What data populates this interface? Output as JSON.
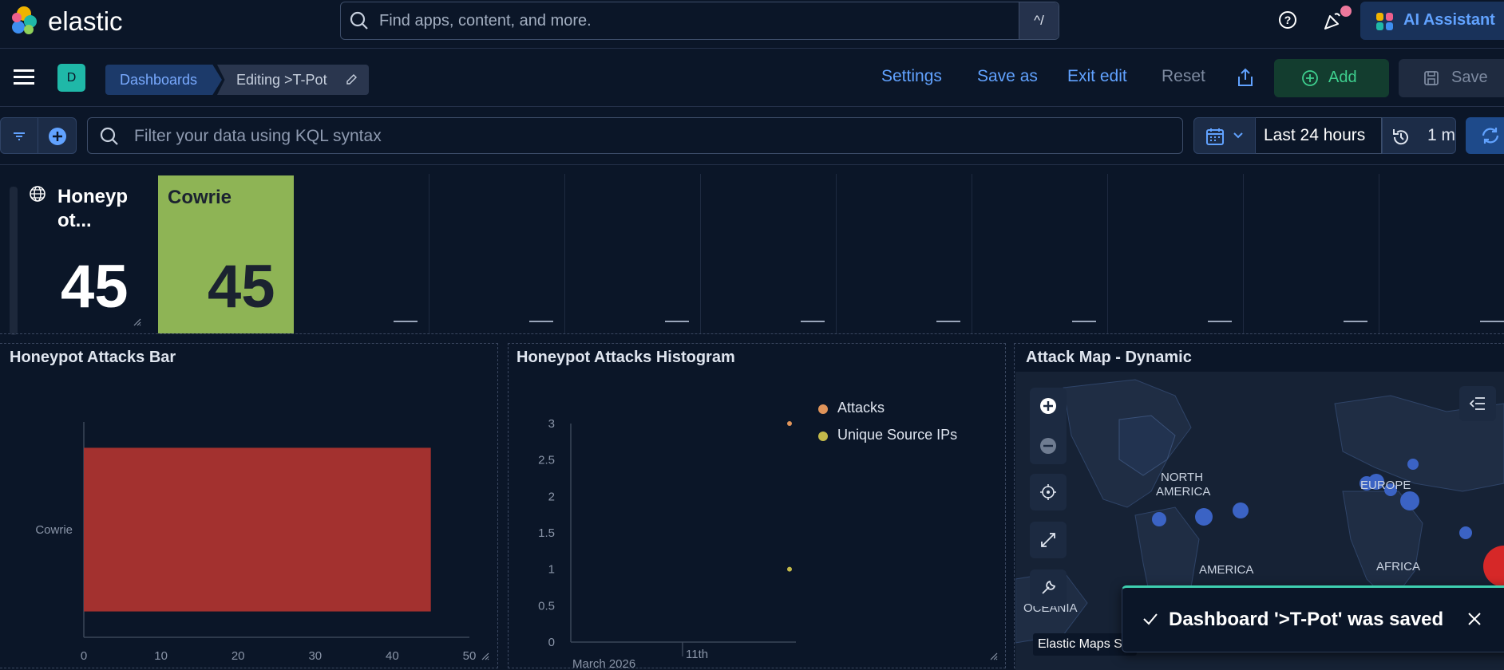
{
  "header": {
    "brand": "elastic",
    "search_placeholder": "Find apps, content, and more.",
    "search_shortcut": "^/",
    "ai_assistant_label": "AI Assistant"
  },
  "nav": {
    "space_initial": "D",
    "breadcrumbs": [
      "Dashboards",
      "Editing >T-Pot"
    ],
    "actions": {
      "settings": "Settings",
      "save_as": "Save as",
      "exit_edit": "Exit edit",
      "reset": "Reset",
      "add": "Add",
      "save": "Save"
    }
  },
  "query": {
    "placeholder": "Filter your data using KQL syntax",
    "time_range": "Last 24 hours",
    "refresh_interval": "1 m"
  },
  "metrics": [
    {
      "title": "Honeyp ot...",
      "title_line1": "Honeyp",
      "title_line2": "ot...",
      "value": "45"
    },
    {
      "title": "Cowrie",
      "value": "45",
      "color": "#8eb455"
    }
  ],
  "panels": {
    "bar": {
      "title": "Honeypot Attacks Bar"
    },
    "histogram": {
      "title": "Honeypot Attacks Histogram"
    },
    "map": {
      "title": "Attack Map - Dynamic",
      "labels": [
        "NORTH",
        "AMERICA",
        "EUROPE",
        "AMERICA",
        "AFRICA",
        "OCEANIA"
      ],
      "attribution": "Elastic Maps S"
    }
  },
  "chart_data": [
    {
      "type": "bar",
      "orientation": "horizontal",
      "categories": [
        "Cowrie"
      ],
      "values": [
        45
      ],
      "xlim": [
        0,
        50
      ],
      "xticks": [
        "0",
        "10",
        "20",
        "30",
        "40",
        "50"
      ],
      "color": "#a3312f"
    },
    {
      "type": "scatter",
      "yticks": [
        "0",
        "0.5",
        "1",
        "1.5",
        "2",
        "2.5",
        "3"
      ],
      "ylim": [
        0,
        3
      ],
      "xlabel_left": "March 2026",
      "xtick": "11th",
      "series": [
        {
          "name": "Attacks",
          "color": "#e0945a",
          "values": [
            3
          ]
        },
        {
          "name": "Unique Source IPs",
          "color": "#c3b94a",
          "values": [
            1
          ]
        }
      ]
    }
  ],
  "toast": {
    "message": "Dashboard '>T-Pot' was saved"
  }
}
